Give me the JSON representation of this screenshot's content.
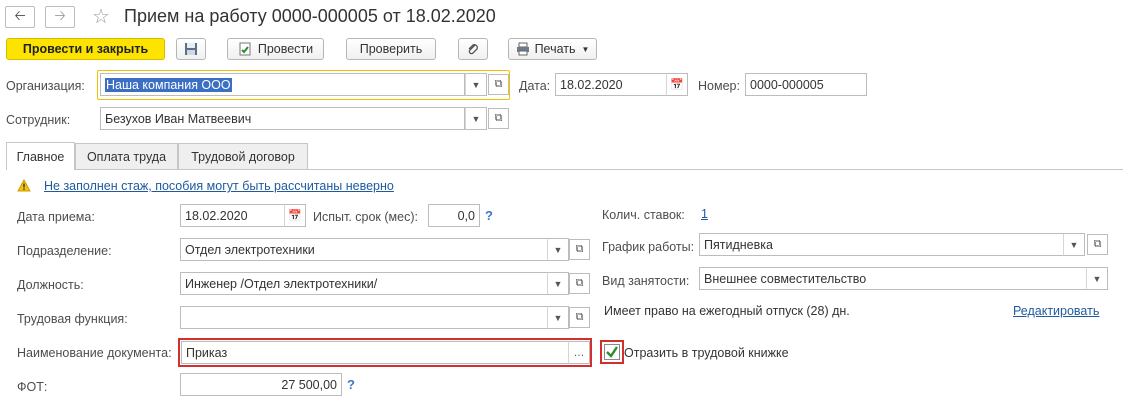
{
  "window": {
    "title": "Прием на работу 0000-000005 от 18.02.2020"
  },
  "nav": {
    "back_icon": "arrow-left-icon",
    "forward_icon": "arrow-right-icon",
    "favorite_icon": "star-icon"
  },
  "toolbar": {
    "post_close": "Провести и закрыть",
    "post": "Провести",
    "check": "Проверить",
    "print": "Печать"
  },
  "header": {
    "org_label": "Организация:",
    "org_value": "Наша компания ООО",
    "date_label": "Дата:",
    "date_value": "18.02.2020",
    "number_label": "Номер:",
    "number_value": "0000-000005",
    "employee_label": "Сотрудник:",
    "employee_value": "Безухов Иван Матвеевич"
  },
  "tabs": [
    "Главное",
    "Оплата труда",
    "Трудовой договор"
  ],
  "main": {
    "warning": "Не заполнен стаж, пособия могут быть рассчитаны неверно",
    "hire_date_label": "Дата приема:",
    "hire_date_value": "18.02.2020",
    "probation_label": "Испыт. срок (мес):",
    "probation_value": "0,0",
    "department_label": "Подразделение:",
    "department_value": "Отдел электротехники",
    "position_label": "Должность:",
    "position_value": "Инженер /Отдел электротехники/",
    "labor_function_label": "Трудовая функция:",
    "labor_function_value": "",
    "doc_name_label": "Наименование документа:",
    "doc_name_value": "Приказ",
    "fot_label": "ФОТ:",
    "fot_value": "27 500,00",
    "rates_label": "Колич. ставок:",
    "rates_value": "1",
    "schedule_label": "График работы:",
    "schedule_value": "Пятидневка",
    "employment_label": "Вид занятости:",
    "employment_value": "Внешнее совместительство",
    "vacation_text": "Имеет право на ежегодный отпуск (28) дн.",
    "edit_link": "Редактировать",
    "workbook_label": "Отразить в трудовой книжке",
    "workbook_checked": true,
    "help_mark": "?"
  },
  "colors": {
    "accent_yellow": "#fce400",
    "focus_border": "#f2c200",
    "highlight_red": "#d32f2f",
    "link_blue": "#1f5a9e",
    "selection_blue": "#3a6fc4"
  }
}
